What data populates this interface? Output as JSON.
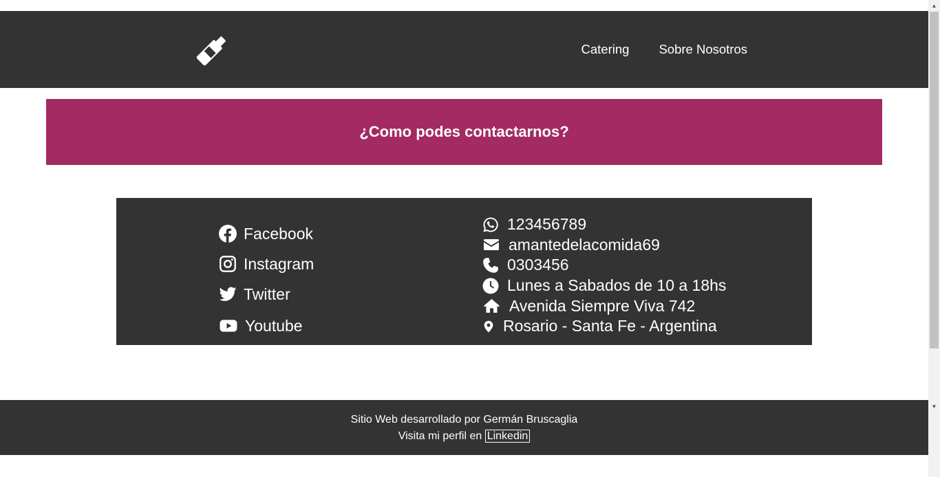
{
  "header": {
    "logo_icon": "wine-bottle-icon",
    "nav": [
      {
        "label": "Catering"
      },
      {
        "label": "Sobre Nosotros"
      }
    ]
  },
  "banner": {
    "title": "¿Como podes contactarnos?",
    "background": "#a42a63"
  },
  "contact": {
    "social": [
      {
        "icon": "facebook-icon",
        "label": "Facebook"
      },
      {
        "icon": "instagram-icon",
        "label": "Instagram"
      },
      {
        "icon": "twitter-icon",
        "label": "Twitter"
      },
      {
        "icon": "youtube-icon",
        "label": "Youtube"
      }
    ],
    "info": [
      {
        "icon": "whatsapp-icon",
        "text": "123456789"
      },
      {
        "icon": "envelope-icon",
        "text": "amantedelacomida69"
      },
      {
        "icon": "phone-icon",
        "text": "0303456"
      },
      {
        "icon": "clock-icon",
        "text": "Lunes a Sabados de 10 a 18hs"
      },
      {
        "icon": "home-icon",
        "text": "Avenida Siempre Viva 742"
      },
      {
        "icon": "map-marker-icon",
        "text": "Rosario - Santa Fe - Argentina"
      }
    ]
  },
  "footer": {
    "credit": "Sitio Web desarrollado por Germán Bruscaglia",
    "profile_prefix": "Visita mi perfil en",
    "profile_link": "Linkedin"
  },
  "colors": {
    "dark": "#333333",
    "accent": "#a42a63",
    "text": "#ffffff"
  }
}
